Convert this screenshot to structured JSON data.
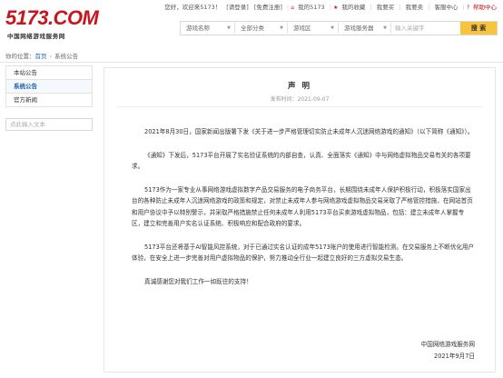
{
  "logo": {
    "brand": "5173.COM",
    "tagline": "中国网络游戏服务网"
  },
  "topbar": {
    "greeting": "您好，欢迎来5173！",
    "login": "[请登录]",
    "register": "[免费注册]",
    "my5173": "我的5173",
    "want_buy": "我的收藏",
    "want_sell": "我要买",
    "sell": "我要卖",
    "service": "客服中心",
    "help": "帮助中心"
  },
  "search": {
    "game_name": "游戏名称",
    "all_categories": "全部分类",
    "game_zone": "游戏区",
    "game_server": "游戏服务器",
    "keyword_placeholder": "输入关键字",
    "button": "搜 索"
  },
  "breadcrumb": {
    "prefix": "你的位置：",
    "home": "首页",
    "current": "系统公告"
  },
  "sidebar": {
    "items": [
      {
        "label": "本站公告"
      },
      {
        "label": "系统公告"
      },
      {
        "label": "官方新闻"
      }
    ],
    "search_placeholder": "点此输入文本"
  },
  "article": {
    "title": "声 明",
    "meta": "发布时间：2021-09-07",
    "paragraphs": [
      "2021年8月30日，国家新闻出版署下发《关于进一步严格管理切实防止未成年人沉迷网络游戏的通知》（以下简称《通知》）。",
      "《通知》下发后，5173平台开展了实名验证系统的内部自查，认真、全面落实《通知》中与网络虚拟物品交易有关的各项要求。",
      "5173作为一家专业从事网络游戏虚拟数字产品交易服务的电子商务平台，长期围绕未成年人保护积极行动，积极落实国家出台的各种防止未成年人沉迷网络游戏的政策和规定，对禁止未成年人参与网络游戏虚拟物品交易采取了严格管控措施，在网站首页和用户协议中予以特别警示，并采取严格措施禁止任何未成年人利用5173平台买卖游戏虚拟物品，包括：建立未成年人掌握专区，建立和完善用户实名认证系统、积极响应和配合政府的要求。",
      "5173平台还将基于AI智能风控系统，对于已通过实名认证的成年5173账户的使用进行智能检测。在交易服务上不断优化用户体验，在安全上进一步完善对用户虚拟物品的保护，努力推动全行业一起建立良好的三方虚拟交易生态。",
      "真诚感谢您对我们工作一如既往的支持！"
    ],
    "signature": "中国网络游戏服务网",
    "date": "2021年9月7日"
  }
}
